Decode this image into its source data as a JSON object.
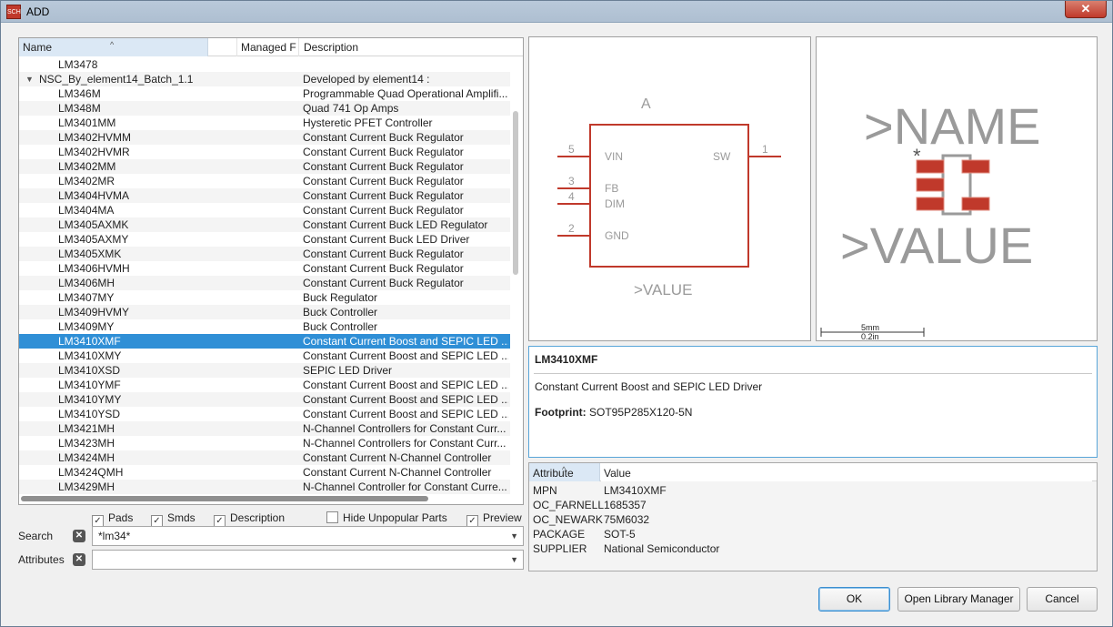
{
  "window": {
    "title": "ADD",
    "close_label": "✕",
    "app_icon_text": "SCH"
  },
  "list": {
    "columns": {
      "name": "Name",
      "managed": "Managed F",
      "description": "Description"
    },
    "rows": [
      {
        "name": "LM3478",
        "description": ""
      },
      {
        "name": "NSC_By_element14_Batch_1.1",
        "description": "Developed by element14 :",
        "group": true
      },
      {
        "name": "LM346M",
        "description": "Programmable Quad Operational Amplifi..."
      },
      {
        "name": "LM348M",
        "description": "Quad 741 Op Amps"
      },
      {
        "name": "LM3401MM",
        "description": "Hysteretic PFET Controller"
      },
      {
        "name": "LM3402HVMM",
        "description": "Constant Current Buck Regulator"
      },
      {
        "name": "LM3402HVMR",
        "description": "Constant Current Buck Regulator"
      },
      {
        "name": "LM3402MM",
        "description": "Constant Current Buck Regulator"
      },
      {
        "name": "LM3402MR",
        "description": "Constant Current Buck Regulator"
      },
      {
        "name": "LM3404HVMA",
        "description": "Constant Current Buck Regulator"
      },
      {
        "name": "LM3404MA",
        "description": "Constant Current Buck Regulator"
      },
      {
        "name": "LM3405AXMK",
        "description": "Constant Current Buck LED Regulator"
      },
      {
        "name": "LM3405AXMY",
        "description": "Constant Current Buck LED Driver"
      },
      {
        "name": "LM3405XMK",
        "description": "Constant Current Buck Regulator"
      },
      {
        "name": "LM3406HVMH",
        "description": "Constant Current Buck Regulator"
      },
      {
        "name": "LM3406MH",
        "description": "Constant Current Buck Regulator"
      },
      {
        "name": "LM3407MY",
        "description": "Buck Regulator"
      },
      {
        "name": "LM3409HVMY",
        "description": "Buck Controller"
      },
      {
        "name": "LM3409MY",
        "description": "Buck Controller"
      },
      {
        "name": "LM3410XMF",
        "description": "Constant Current Boost and SEPIC LED ...",
        "selected": true
      },
      {
        "name": "LM3410XMY",
        "description": "Constant Current Boost and SEPIC LED ..."
      },
      {
        "name": "LM3410XSD",
        "description": "SEPIC LED Driver"
      },
      {
        "name": "LM3410YMF",
        "description": "Constant Current Boost and SEPIC LED ..."
      },
      {
        "name": "LM3410YMY",
        "description": "Constant Current Boost and SEPIC LED ..."
      },
      {
        "name": "LM3410YSD",
        "description": "Constant Current Boost and SEPIC LED ..."
      },
      {
        "name": "LM3421MH",
        "description": "N-Channel Controllers for Constant Curr..."
      },
      {
        "name": "LM3423MH",
        "description": "N-Channel Controllers for Constant Curr..."
      },
      {
        "name": "LM3424MH",
        "description": "Constant Current N-Channel Controller"
      },
      {
        "name": "LM3424QMH",
        "description": "Constant Current N-Channel Controller"
      },
      {
        "name": "LM3429MH",
        "description": "N-Channel Controller for Constant Curre..."
      }
    ]
  },
  "options": {
    "pads": {
      "label": "Pads",
      "checked": true
    },
    "smds": {
      "label": "Smds",
      "checked": true
    },
    "description": {
      "label": "Description",
      "checked": true
    },
    "hide_unpopular": {
      "label": "Hide Unpopular Parts",
      "checked": false
    },
    "preview": {
      "label": "Preview",
      "checked": true
    }
  },
  "search": {
    "label": "Search",
    "value": "*lm34*"
  },
  "attributes_filter": {
    "label": "Attributes",
    "value": ""
  },
  "symbol": {
    "prefix": "A",
    "value_text": ">VALUE",
    "pins_left": [
      {
        "num": "5",
        "name": "VIN"
      },
      {
        "num": "3",
        "name": "FB"
      },
      {
        "num": "4",
        "name": "DIM"
      },
      {
        "num": "2",
        "name": "GND"
      }
    ],
    "pins_right": [
      {
        "num": "1",
        "name": "SW"
      }
    ]
  },
  "footprint": {
    "name_text": ">NAME",
    "value_text": ">VALUE",
    "pin1_mark": "*",
    "scale_top": "5mm",
    "scale_bottom": "0.2in"
  },
  "details": {
    "part_name": "LM3410XMF",
    "description": "Constant Current Boost and SEPIC LED Driver",
    "footprint_label": "Footprint:",
    "footprint_value": "SOT95P285X120-5N"
  },
  "attribute_table": {
    "columns": {
      "attribute": "Attribute",
      "value": "Value"
    },
    "rows": [
      {
        "key": "MPN",
        "value": "LM3410XMF"
      },
      {
        "key": "OC_FARNELL",
        "value": "1685357"
      },
      {
        "key": "OC_NEWARK",
        "value": "75M6032"
      },
      {
        "key": "PACKAGE",
        "value": "SOT-5"
      },
      {
        "key": "SUPPLIER",
        "value": "National Semiconductor"
      }
    ]
  },
  "buttons": {
    "ok": "OK",
    "library_manager": "Open Library Manager",
    "cancel": "Cancel"
  },
  "colors": {
    "symbol_red": "#c0392b",
    "selection": "#2f8fd6",
    "footprint_gray": "#9a9a9a"
  }
}
